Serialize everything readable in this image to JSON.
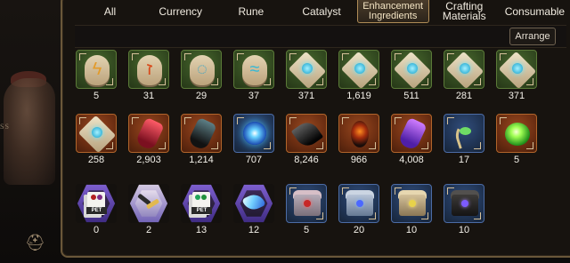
{
  "tabs": [
    {
      "label": "All"
    },
    {
      "label": "Currency"
    },
    {
      "label": "Rune"
    },
    {
      "label": "Catalyst"
    },
    {
      "label": "Enhancement\nIngredients",
      "active": true
    },
    {
      "label": "Crafting\nMaterials"
    },
    {
      "label": "Consumable"
    }
  ],
  "toolbar": {
    "arrange_label": "Arrange"
  },
  "background": {
    "label": "SS"
  },
  "items": {
    "row1": [
      {
        "icon": "rune-lightning-icon",
        "qty": "5"
      },
      {
        "icon": "rune-flame-icon",
        "qty": "31"
      },
      {
        "icon": "rune-circle-icon",
        "qty": "29"
      },
      {
        "icon": "rune-wave-icon",
        "qty": "37"
      },
      {
        "icon": "crystal-shard-icon",
        "qty": "371"
      },
      {
        "icon": "crystal-shard-icon",
        "qty": "1,619"
      },
      {
        "icon": "crystal-shard-icon",
        "qty": "511"
      },
      {
        "icon": "crystal-shard-icon",
        "qty": "281"
      },
      {
        "icon": "crystal-shard-icon",
        "qty": "371"
      }
    ],
    "row2": [
      {
        "icon": "crystal-shard-icon",
        "qty": "258"
      },
      {
        "icon": "red-gem-icon",
        "qty": "2,903"
      },
      {
        "icon": "dark-feather-icon",
        "qty": "1,214"
      },
      {
        "icon": "blue-orb-icon",
        "qty": "707"
      },
      {
        "icon": "black-feather-icon",
        "qty": "8,246"
      },
      {
        "icon": "dark-egg-icon",
        "qty": "966"
      },
      {
        "icon": "purple-crystal-icon",
        "qty": "4,008"
      },
      {
        "icon": "green-branch-icon",
        "qty": "17"
      },
      {
        "icon": "green-orb-icon",
        "qty": "5"
      }
    ],
    "row3": [
      {
        "icon": "pet-card-icon",
        "qty": "0"
      },
      {
        "icon": "scroll-tool-icon",
        "qty": "2"
      },
      {
        "icon": "pet-card-icon",
        "qty": "13"
      },
      {
        "icon": "blue-gem-hex-icon",
        "qty": "12"
      },
      {
        "icon": "chest-icon",
        "qty": "5"
      },
      {
        "icon": "chest-icon",
        "qty": "20"
      },
      {
        "icon": "chest-icon",
        "qty": "10"
      },
      {
        "icon": "chest-icon",
        "qty": "10"
      }
    ]
  },
  "colors": {
    "text": "#f4f1ea",
    "panel": "#17130f",
    "border": "#6a5739",
    "active_tab": "#b08d57"
  }
}
